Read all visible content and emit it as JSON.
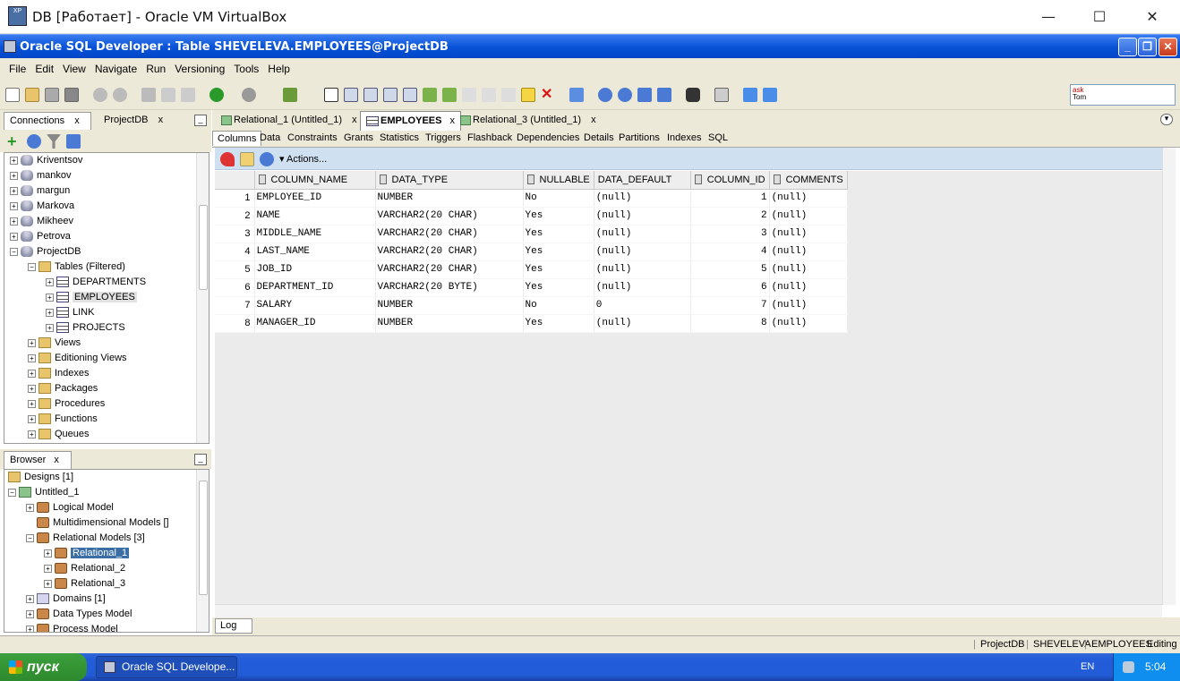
{
  "outer_window": {
    "title": "DB [Работает] - Oracle VM VirtualBox",
    "minimize": "—",
    "maximize": "☐",
    "close": "✕"
  },
  "app_window": {
    "title": "Oracle SQL Developer : Table SHEVELEVA.EMPLOYEES@ProjectDB"
  },
  "menu": [
    "File",
    "Edit",
    "View",
    "Navigate",
    "Run",
    "Versioning",
    "Tools",
    "Help"
  ],
  "ask_tom": {
    "line1": "ask",
    "line2": "Tom"
  },
  "connections_panel": {
    "tabs": [
      "Connections",
      "ProjectDB"
    ],
    "items": [
      {
        "label": "Kriventsov",
        "icon": "database-icon"
      },
      {
        "label": "mankov",
        "icon": "database-icon"
      },
      {
        "label": "margun",
        "icon": "database-icon"
      },
      {
        "label": "Markova",
        "icon": "database-icon"
      },
      {
        "label": "Mikheev",
        "icon": "database-icon"
      },
      {
        "label": "Petrova",
        "icon": "database-icon"
      },
      {
        "label": "ProjectDB",
        "icon": "database-icon"
      },
      {
        "label": "Tables (Filtered)",
        "icon": "folder-icon"
      },
      {
        "label": "DEPARTMENTS",
        "icon": "table-icon"
      },
      {
        "label": "EMPLOYEES",
        "icon": "table-icon"
      },
      {
        "label": "LINK",
        "icon": "table-icon"
      },
      {
        "label": "PROJECTS",
        "icon": "table-icon"
      },
      {
        "label": "Views",
        "icon": "folder-icon"
      },
      {
        "label": "Editioning Views",
        "icon": "folder-icon"
      },
      {
        "label": "Indexes",
        "icon": "folder-icon"
      },
      {
        "label": "Packages",
        "icon": "folder-icon"
      },
      {
        "label": "Procedures",
        "icon": "folder-icon"
      },
      {
        "label": "Functions",
        "icon": "folder-icon"
      },
      {
        "label": "Queues",
        "icon": "folder-icon"
      }
    ]
  },
  "browser_panel": {
    "tab": "Browser",
    "items": [
      {
        "label": "Designs [1]"
      },
      {
        "label": "Untitled_1"
      },
      {
        "label": "Logical Model"
      },
      {
        "label": "Multidimensional Models []"
      },
      {
        "label": "Relational Models [3]"
      },
      {
        "label": "Relational_1"
      },
      {
        "label": "Relational_2"
      },
      {
        "label": "Relational_3"
      },
      {
        "label": "Domains [1]"
      },
      {
        "label": "Data Types Model"
      },
      {
        "label": "Process Model"
      }
    ]
  },
  "editor_tabs": [
    "Relational_1 (Untitled_1)",
    "EMPLOYEES",
    "Relational_3 (Untitled_1)"
  ],
  "sub_tabs": [
    "Columns",
    "Data",
    "Constraints",
    "Grants",
    "Statistics",
    "Triggers",
    "Flashback",
    "Dependencies",
    "Details",
    "Partitions",
    "Indexes",
    "SQL"
  ],
  "actions_label": "Actions...",
  "grid": {
    "headers": [
      "COLUMN_NAME",
      "DATA_TYPE",
      "NULLABLE",
      "DATA_DEFAULT",
      "COLUMN_ID",
      "COMMENTS"
    ],
    "rows": [
      [
        "1",
        "EMPLOYEE_ID",
        "NUMBER",
        "No",
        "(null)",
        "1",
        "(null)"
      ],
      [
        "2",
        "NAME",
        "VARCHAR2(20 CHAR)",
        "Yes",
        "(null)",
        "2",
        "(null)"
      ],
      [
        "3",
        "MIDDLE_NAME",
        "VARCHAR2(20 CHAR)",
        "Yes",
        "(null)",
        "3",
        "(null)"
      ],
      [
        "4",
        "LAST_NAME",
        "VARCHAR2(20 CHAR)",
        "Yes",
        "(null)",
        "4",
        "(null)"
      ],
      [
        "5",
        "JOB_ID",
        "VARCHAR2(20 CHAR)",
        "Yes",
        "(null)",
        "5",
        "(null)"
      ],
      [
        "6",
        "DEPARTMENT_ID",
        "VARCHAR2(20 BYTE)",
        "Yes",
        "(null)",
        "6",
        "(null)"
      ],
      [
        "7",
        "SALARY",
        "NUMBER",
        "No",
        "0",
        "7",
        "(null)"
      ],
      [
        "8",
        "MANAGER_ID",
        "NUMBER",
        "Yes",
        "(null)",
        "8",
        "(null)"
      ]
    ]
  },
  "log_tab": "Log",
  "status_bar": {
    "connection": "ProjectDB",
    "schema": "SHEVELEVA",
    "object": "EMPLOYEES",
    "mode": "Editing"
  },
  "taskbar": {
    "start": "пуск",
    "task": "Oracle SQL Develope...",
    "lang": "EN",
    "time": "5:04"
  }
}
